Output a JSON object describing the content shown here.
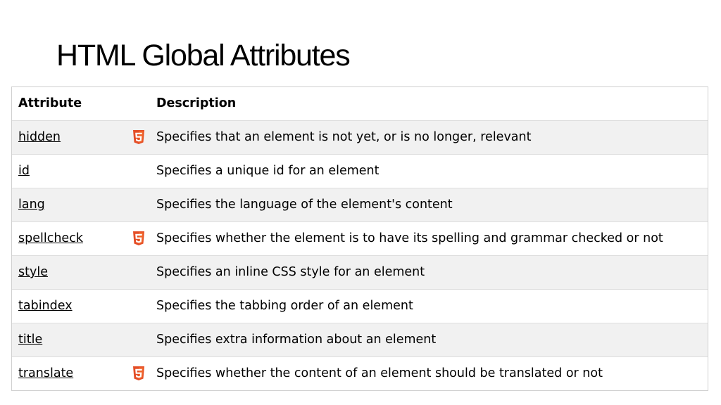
{
  "slide": {
    "title": "HTML Global Attributes"
  },
  "table": {
    "headers": {
      "attribute": "Attribute",
      "description": "Description"
    },
    "rows": [
      {
        "attribute": "hidden",
        "html5": true,
        "description": "Specifies that an element is not yet, or is no longer, relevant"
      },
      {
        "attribute": "id",
        "html5": false,
        "description": "Specifies a unique id for an element"
      },
      {
        "attribute": "lang",
        "html5": false,
        "description": "Specifies the language of the element's content"
      },
      {
        "attribute": "spellcheck",
        "html5": true,
        "description": "Specifies whether the element is to have its spelling and grammar checked or not"
      },
      {
        "attribute": "style",
        "html5": false,
        "description": "Specifies an inline CSS style for an element"
      },
      {
        "attribute": "tabindex",
        "html5": false,
        "description": "Specifies the tabbing order of an element"
      },
      {
        "attribute": "title",
        "html5": false,
        "description": "Specifies extra information about an element"
      },
      {
        "attribute": "translate",
        "html5": true,
        "description": "Specifies whether the content of an element should be translated or not"
      }
    ]
  },
  "icons": {
    "html5_badge": "html5-icon"
  },
  "colors": {
    "html5_badge": "#e44d26",
    "html5_badge_light": "#f16529",
    "row_alt": "#f1f1f1"
  }
}
